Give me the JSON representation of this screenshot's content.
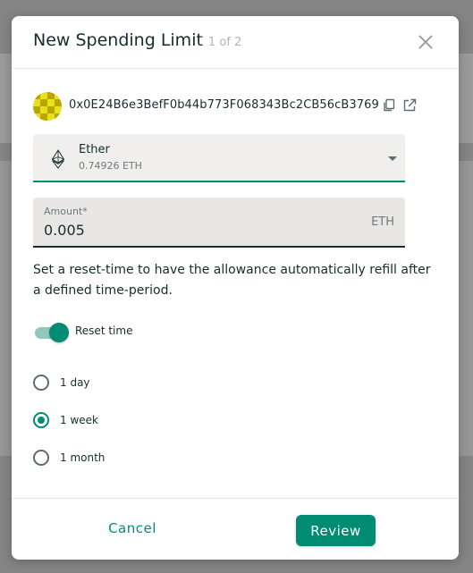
{
  "modal": {
    "title": "New Spending Limit",
    "step": "1 of 2"
  },
  "beneficiary": {
    "address": "0x0E24B6e3BefF0b44b773F068343Bc2CB56cB3769"
  },
  "token": {
    "name": "Ether",
    "balance": "0.74926 ETH"
  },
  "amount": {
    "label": "Amount*",
    "value": "0.005",
    "unit": "ETH"
  },
  "description": "Set a reset-time to have the allowance automatically refill after a defined time-period.",
  "reset_time": {
    "label": "Reset time",
    "enabled": true
  },
  "periods": {
    "options": [
      "1 day",
      "1 week",
      "1 month"
    ],
    "selected": "1 week"
  },
  "footer": {
    "cancel_label": "Cancel",
    "review_label": "Review"
  },
  "colors": {
    "accent": "#008c73",
    "identicon": "#e6e31c"
  },
  "icons": {
    "close": "close-icon",
    "copy": "copy-icon",
    "external": "external-link-icon",
    "token": "ethereum-icon",
    "dropdown": "chevron-down-icon"
  }
}
